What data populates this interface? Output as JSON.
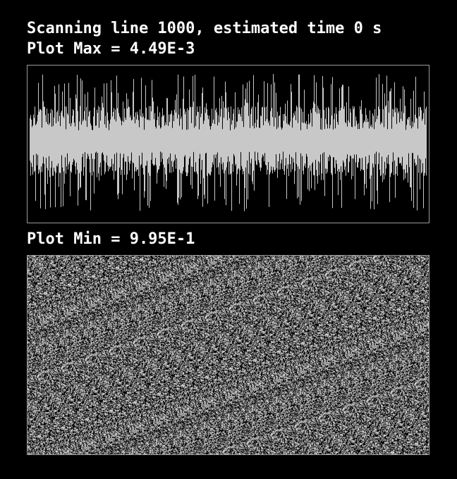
{
  "status": {
    "scan_text": "Scanning line 1000, estimated time 0 s",
    "plot_max_text": "Plot Max = 4.49E-3",
    "plot_min_text": "Plot Min = 9.95E-1"
  },
  "colors": {
    "background": "#000000",
    "text": "#ffffff",
    "waveform": "#c8c8c8",
    "frame": "#9a9a9a"
  },
  "icons": []
}
